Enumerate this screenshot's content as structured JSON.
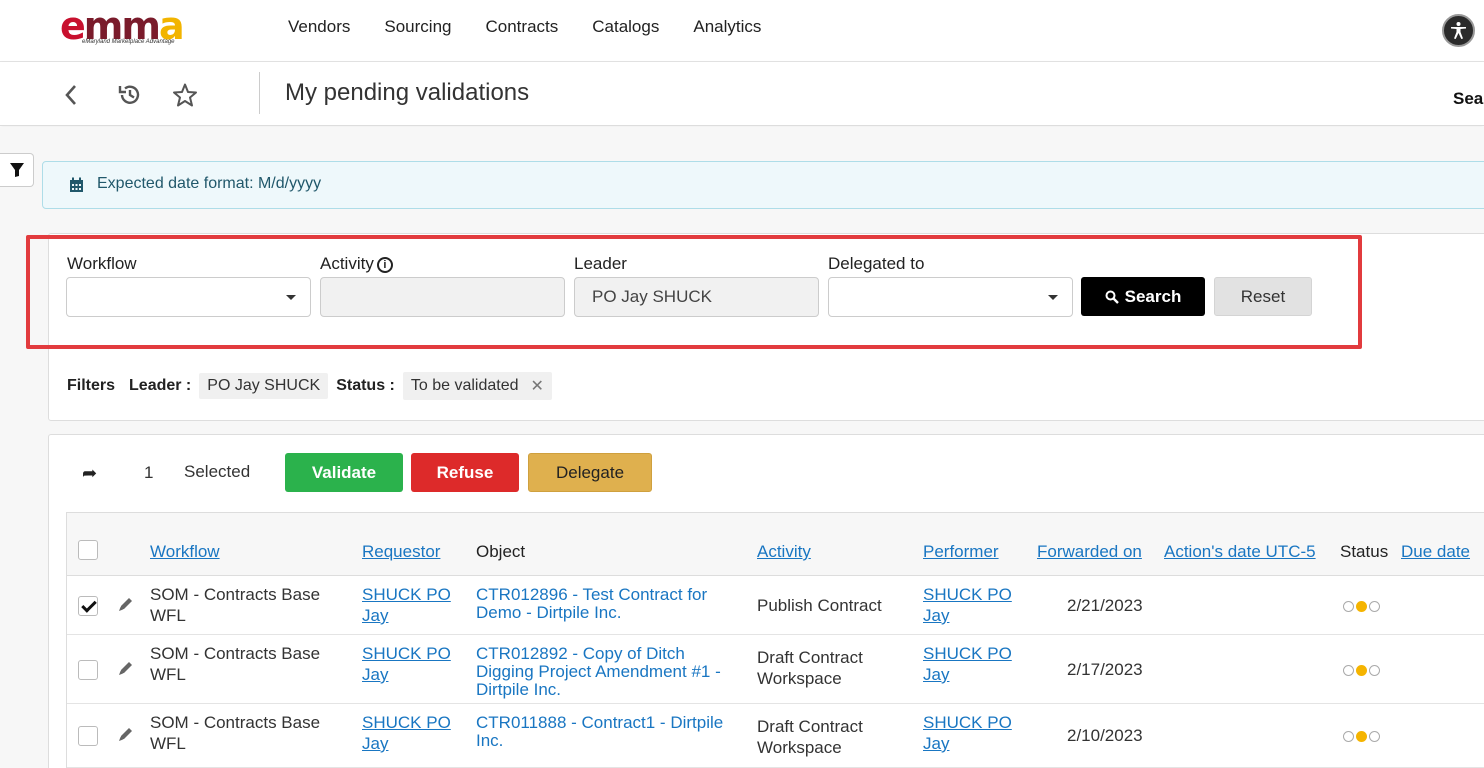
{
  "nav": {
    "logo": "emma",
    "logo_tagline": "eMaryland Marketplace Advantage",
    "links": [
      "Vendors",
      "Sourcing",
      "Contracts",
      "Catalogs",
      "Analytics"
    ]
  },
  "subheader": {
    "title": "My pending validations",
    "search_label": "Sear"
  },
  "info": {
    "date_format": "Expected date format: M/d/yyyy"
  },
  "filter_form": {
    "workflow_label": "Workflow",
    "workflow_value": "",
    "activity_label": "Activity",
    "activity_value": "",
    "leader_label": "Leader",
    "leader_value": "PO Jay SHUCK",
    "delegated_label": "Delegated to",
    "delegated_value": "",
    "search_button": "Search",
    "reset_button": "Reset"
  },
  "active_filters": {
    "title": "Filters",
    "leader_label": "Leader :",
    "leader_value": "PO Jay SHUCK",
    "status_label": "Status :",
    "status_value": "To be validated"
  },
  "selection": {
    "count": "1",
    "label": "Selected",
    "validate": "Validate",
    "refuse": "Refuse",
    "delegate": "Delegate"
  },
  "table": {
    "columns": [
      "Workflow",
      "Requestor",
      "Object",
      "Activity",
      "Performer",
      "Forwarded on",
      "Action's date UTC-5",
      "Status",
      "Due date"
    ],
    "rows": [
      {
        "checked": true,
        "workflow": [
          "SOM - Contracts Base",
          "WFL"
        ],
        "requestor": [
          "SHUCK PO",
          "Jay"
        ],
        "object": [
          "CTR012896 - Test Contract for",
          "Demo - Dirtpile Inc."
        ],
        "activity": [
          "Publish Contract"
        ],
        "performer": [
          "SHUCK PO",
          "Jay"
        ],
        "forwarded_on": "2/21/2023",
        "status_level": 2
      },
      {
        "checked": false,
        "workflow": [
          "SOM - Contracts Base",
          "WFL"
        ],
        "requestor": [
          "SHUCK PO",
          "Jay"
        ],
        "object": [
          "CTR012892 - Copy of Ditch",
          "Digging Project Amendment #1 -",
          "Dirtpile Inc."
        ],
        "activity": [
          "Draft Contract",
          "Workspace"
        ],
        "performer": [
          "SHUCK PO",
          "Jay"
        ],
        "forwarded_on": "2/17/2023",
        "status_level": 2
      },
      {
        "checked": false,
        "workflow": [
          "SOM - Contracts Base",
          "WFL"
        ],
        "requestor": [
          "SHUCK PO",
          "Jay"
        ],
        "object": [
          "CTR011888 - Contract1 - Dirtpile",
          "Inc."
        ],
        "activity": [
          "Draft Contract",
          "Workspace"
        ],
        "performer": [
          "SHUCK PO",
          "Jay"
        ],
        "forwarded_on": "2/10/2023",
        "status_level": 2
      }
    ]
  },
  "colors": {
    "link": "#1976c2",
    "validate": "#2bb24c",
    "refuse": "#dd2a2a",
    "delegate": "#dfb04e",
    "highlight": "#e23b3e",
    "status_on": "#f5b400"
  }
}
